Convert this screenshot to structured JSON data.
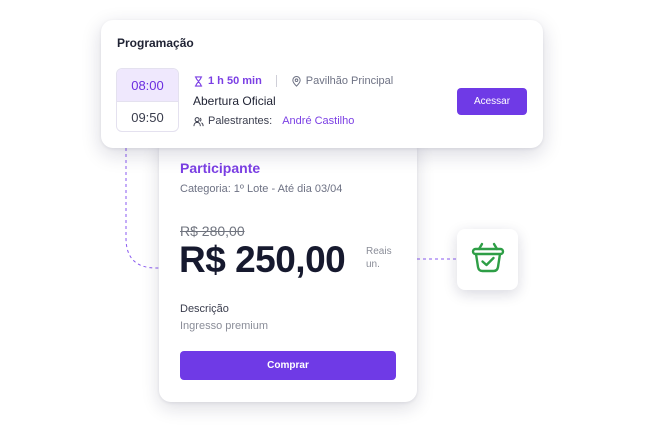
{
  "schedule": {
    "title": "Programação",
    "time_start": "08:00",
    "time_end": "09:50",
    "duration": "1 h 50 min",
    "location": "Pavilhão Principal",
    "session_title": "Abertura Oficial",
    "speakers_label": "Palestrantes:",
    "speaker_name": "André Castilho",
    "access_label": "Acessar"
  },
  "ticket": {
    "title": "Participante",
    "category": "Categoria: 1º Lote - Até dia 03/04",
    "old_price": "R$ 280,00",
    "price": "R$ 250,00",
    "price_unit": "Reais un.",
    "description_label": "Descrição",
    "description_value": "Ingresso premium",
    "buy_label": "Comprar"
  },
  "icons": {
    "hourglass": "hourglass-icon",
    "location": "location-pin-icon",
    "speakers": "users-icon",
    "basket": "basket-check-icon"
  },
  "colors": {
    "accent": "#6f3ae6",
    "accent_text": "#7b3fe4",
    "time_highlight_bg": "#efe8fd",
    "basket_green": "#2e9e46",
    "price_dark": "#16192e"
  }
}
